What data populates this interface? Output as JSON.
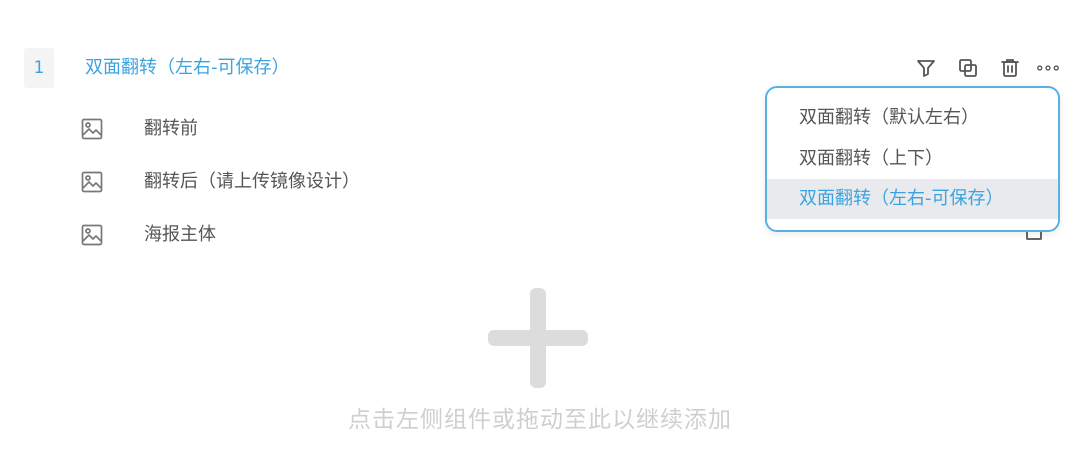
{
  "group": {
    "index": "1",
    "title": "双面翻转（左右-可保存）"
  },
  "toolbar": {
    "icons": [
      "filter-icon",
      "copy-icon",
      "trash-icon",
      "more-icon"
    ]
  },
  "layers": [
    {
      "icon": "image-icon",
      "label": "翻转前"
    },
    {
      "icon": "image-icon",
      "label": "翻转后（请上传镜像设计）"
    },
    {
      "icon": "image-icon",
      "label": "海报主体"
    }
  ],
  "dropdown": {
    "options": [
      "双面翻转（默认左右）",
      "双面翻转（上下）",
      "双面翻转（左右-可保存）"
    ],
    "selected": "双面翻转（左右-可保存）"
  },
  "add_area": {
    "hint": "点击左侧组件或拖动至此以继续添加"
  },
  "colors": {
    "accent": "#3aa4e0",
    "dropdown_border": "#59b1e3",
    "selected_bg": "#e8eaee",
    "hint": "#cfcfcf"
  }
}
